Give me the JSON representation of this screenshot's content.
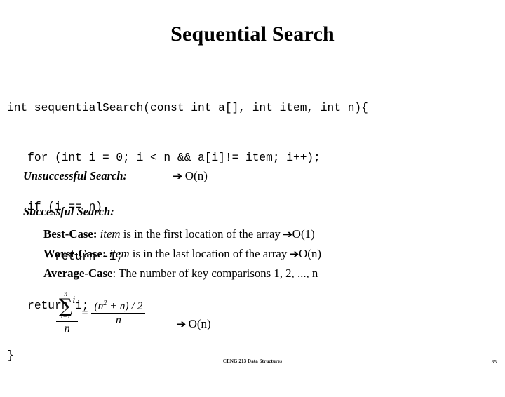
{
  "slide": {
    "title": "Sequential Search",
    "code_lines": [
      "int sequentialSearch(const int a[], int item, int n){",
      "   for (int i = 0; i < n && a[i]!= item; i++);",
      "   if (i == n)",
      "       return -1;",
      "   return i;",
      "}"
    ],
    "unsuccessful": {
      "label": "Unsuccessful Search:",
      "arrow": "arrow-right-icon",
      "arrow_glyph": "➔",
      "complexity": "O(n)"
    },
    "successful": {
      "label": "Successful Search:",
      "cases": [
        {
          "label": "Best-Case:",
          "text_italic": "item",
          "text_rest": " is in the first location of the array ",
          "arrow_glyph": "➔",
          "complexity": "O(1)"
        },
        {
          "label": "Worst-Case:",
          "text_italic": "item",
          "text_rest": " is in the last location of the array ",
          "arrow_glyph": "➔",
          "complexity": "O(n)"
        },
        {
          "label": "Average-Case",
          "text_italic": "",
          "text_rest": ": The number of key comparisons 1, 2, ..., n",
          "arrow_glyph": "",
          "complexity": ""
        }
      ]
    },
    "formula": {
      "sum_upper": "n",
      "sum_lower": "i=1",
      "sigma": "∑",
      "summand": "i",
      "denominator_left": "n",
      "equals": "=",
      "numerator_right_pre": "(",
      "numerator_right_base": "n",
      "numerator_right_exp": "2",
      "numerator_right_post": " + n) / 2",
      "denominator_right": "n",
      "arrow_glyph": "➔",
      "complexity": "O(n)"
    },
    "footer": {
      "center": "CENG 213 Data Structures",
      "page": "35"
    }
  }
}
